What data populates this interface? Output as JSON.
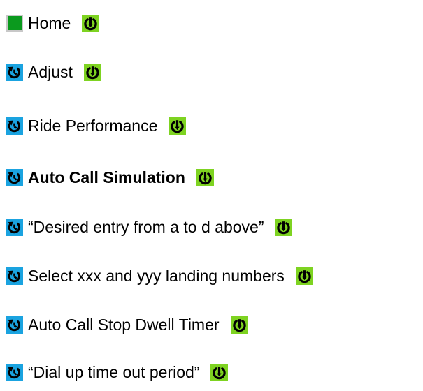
{
  "colors": {
    "home_square": "#0b9a1e",
    "home_border": "#c8c8c8",
    "cycle_icon_bg": "#1aa3e0",
    "arrow_icon_bg": "#7ed321",
    "arrow_icon_fg": "#000000"
  },
  "icons": {
    "leading_home": "green-square-icon",
    "leading_step": "cycle-icon",
    "trailing": "down-arrow-icon"
  },
  "steps": [
    {
      "label": "Home",
      "bold": false
    },
    {
      "label": "Adjust",
      "bold": false
    },
    {
      "label": "Ride Performance",
      "bold": false
    },
    {
      "label": "Auto Call Simulation",
      "bold": true
    },
    {
      "label": "“Desired entry from a to d above”",
      "bold": false
    },
    {
      "label": "Select xxx and yyy landing numbers",
      "bold": false
    },
    {
      "label": "Auto Call Stop Dwell Timer",
      "bold": false
    },
    {
      "label": "“Dial up time out period”",
      "bold": false
    }
  ]
}
